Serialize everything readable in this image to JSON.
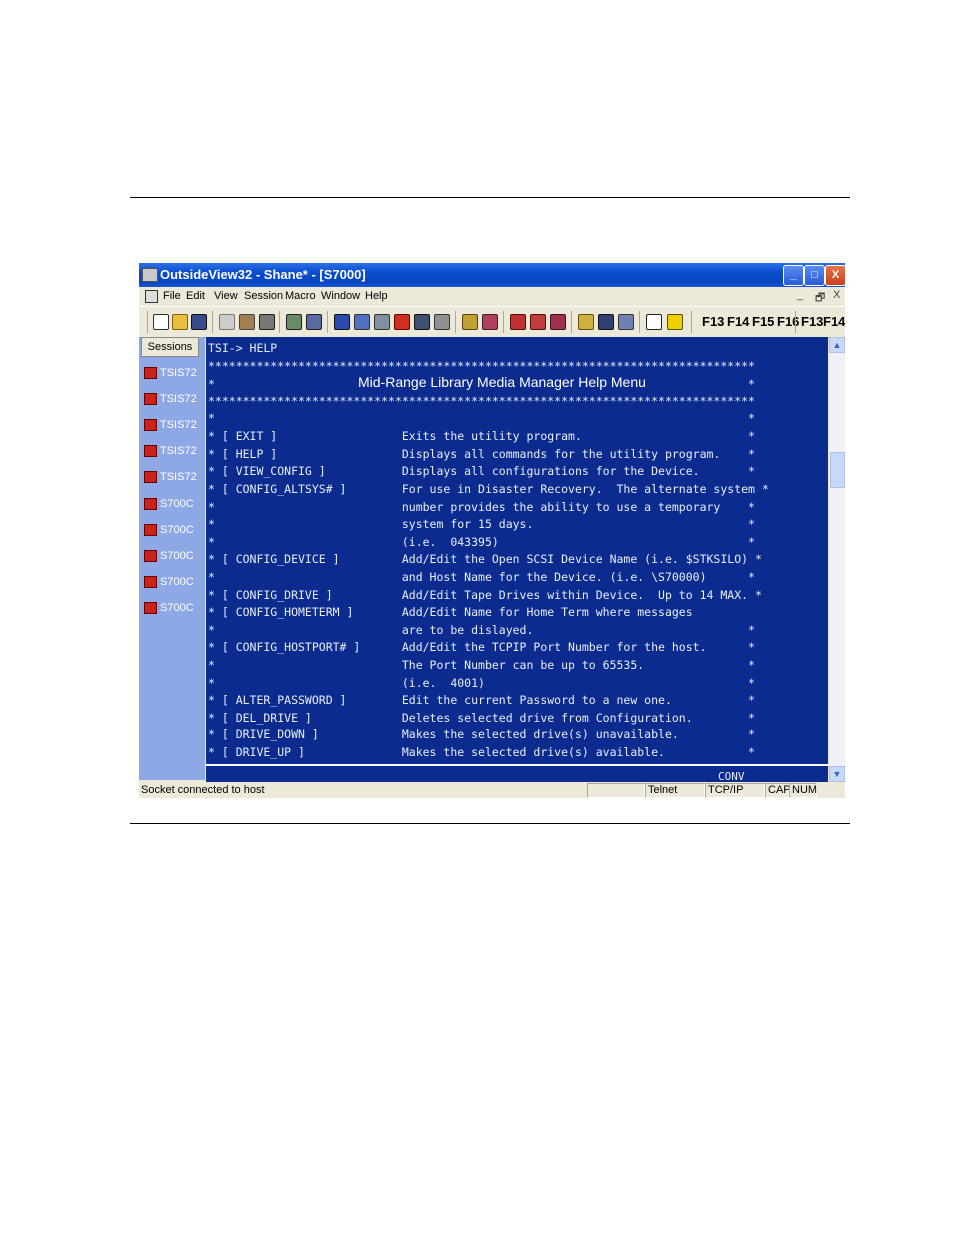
{
  "window": {
    "title": "OutsideView32 - Shane* - [S7000]",
    "buttons": {
      "minimize": "_",
      "maximize": "□",
      "close": "X"
    },
    "mdi_controls": {
      "minimize": "_",
      "restore": "🗗",
      "close": "X"
    }
  },
  "menu": [
    "File",
    "Edit",
    "View",
    "Session",
    "Macro",
    "Window",
    "Help"
  ],
  "toolbar": {
    "fkeys_left": [
      "F13",
      "F14",
      "F15",
      "F16"
    ],
    "fkeys_right": [
      "F13",
      "F14"
    ],
    "icons": [
      "new-icon",
      "open-icon",
      "save-icon",
      "copy-icon",
      "paste-icon",
      "print-icon",
      "connect-icon",
      "transfer-icon",
      "terminal-icon",
      "keyboard-icon",
      "keymap-icon",
      "function-icon",
      "macro-icon",
      "record-icon",
      "tools-icon",
      "settings-icon",
      "network-icon",
      "network2-icon",
      "network3-icon",
      "cut-icon",
      "save2-icon",
      "properties-icon",
      "window-icon",
      "help-icon"
    ]
  },
  "sessions": {
    "tab_label": "Sessions",
    "items": [
      "TSIS72",
      "TSIS72",
      "TSIS72",
      "TSIS72",
      "TSIS72",
      "S700C",
      "S700C",
      "S700C",
      "S700C",
      "S700C"
    ]
  },
  "terminal": {
    "prompt": "TSI-> HELP",
    "menu_title": "Mid-Range Library Media Manager Help Menu",
    "lines": [
      "*******************************************************************************",
      "*                                                                             *",
      "*******************************************************************************",
      "*                                                                             *",
      "* [ EXIT ]                  Exits the utility program.                        *",
      "* [ HELP ]                  Displays all commands for the utility program.    *",
      "* [ VIEW_CONFIG ]           Displays all configurations for the Device.       *",
      "* [ CONFIG_ALTSYS# ]        For use in Disaster Recovery.  The alternate system *",
      "*                           number provides the ability to use a temporary    *",
      "*                           system for 15 days.                               *",
      "*                           (i.e.  043395)                                    *",
      "* [ CONFIG_DEVICE ]         Add/Edit the Open SCSI Device Name (i.e. $STKSILO) *",
      "*                           and Host Name for the Device. (i.e. \\S70000)      *",
      "* [ CONFIG_DRIVE ]          Add/Edit Tape Drives within Device.  Up to 14 MAX. *",
      "* [ CONFIG_HOMETERM ]       Add/Edit Name for Home Term where messages         ",
      "*                           are to be dislayed.                               *",
      "* [ CONFIG_HOSTPORT# ]      Add/Edit the TCPIP Port Number for the host.      *",
      "*                           The Port Number can be up to 65535.               *",
      "*                           (i.e.  4001)                                      *",
      "* [ ALTER_PASSWORD ]        Edit the current Password to a new one.           *",
      "* [ DEL_DRIVE ]             Deletes selected drive from Configuration.        *",
      "* [ DRIVE_DOWN ]            Makes the selected drive(s) unavailable.          *",
      "* [ DRIVE_UP ]              Makes the selected drive(s) available.            *"
    ],
    "status_word": "CONV"
  },
  "statusbar": {
    "message": "Socket connected to host",
    "protocol": "Telnet",
    "transport": "TCP/IP",
    "caps": "CAP",
    "num": "NUM"
  }
}
